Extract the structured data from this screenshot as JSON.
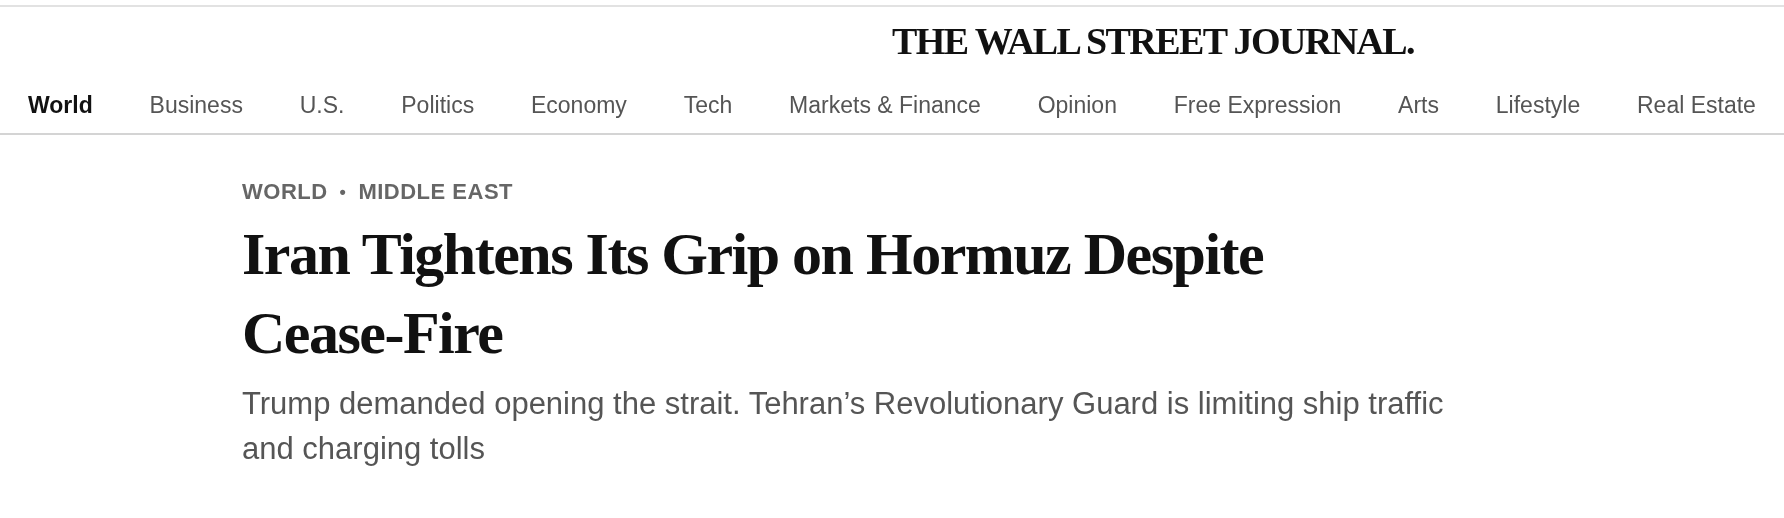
{
  "masthead": {
    "title": "THE WALL STREET JOURNAL."
  },
  "nav": [
    {
      "label": "World",
      "selected": true
    },
    {
      "label": "Business",
      "selected": false
    },
    {
      "label": "U.S.",
      "selected": false
    },
    {
      "label": "Politics",
      "selected": false
    },
    {
      "label": "Economy",
      "selected": false
    },
    {
      "label": "Tech",
      "selected": false
    },
    {
      "label": "Markets & Finance",
      "selected": false
    },
    {
      "label": "Opinion",
      "selected": false
    },
    {
      "label": "Free Expression",
      "selected": false
    },
    {
      "label": "Arts",
      "selected": false
    },
    {
      "label": "Lifestyle",
      "selected": false
    },
    {
      "label": "Real Estate",
      "selected": false
    }
  ],
  "article": {
    "breadcrumbs": [
      "WORLD",
      "MIDDLE EAST"
    ],
    "separator": "•",
    "headline": "Iran Tightens Its Grip on Hormuz Despite Cease-Fire",
    "dek": "Trump demanded opening the strait. Tehran’s Revolutionary Guard is limiting ship traffic and charging tolls"
  }
}
